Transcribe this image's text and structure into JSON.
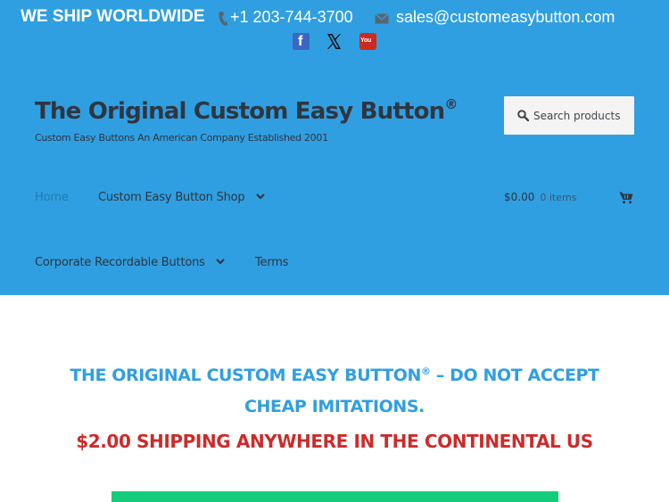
{
  "topbar": {
    "ship_text": "WE SHIP WORLDWIDE",
    "phone": "+1 203-744-3700",
    "email": "sales@customeasybutton.com",
    "icons": [
      "phone-icon",
      "mail-icon"
    ]
  },
  "social": {
    "facebook_glyph": "f",
    "youtube_glyph": "You",
    "icons": [
      "facebook-icon",
      "x-icon",
      "youtube-icon"
    ]
  },
  "site": {
    "title": "The Original Custom Easy Button",
    "title_mark": "®",
    "tagline": "Custom Easy Buttons An American Company Established 2001"
  },
  "search": {
    "placeholder": "Search products"
  },
  "nav": {
    "home": "Home",
    "shop": "Custom Easy Button Shop",
    "corporate": "Corporate Recordable Buttons",
    "terms": "Terms"
  },
  "cart": {
    "amount": "$0.00",
    "items": "0 items"
  },
  "main": {
    "heading_part1": "THE ORIGINAL CUSTOM EASY BUTTON",
    "heading_mark": "®",
    "heading_part2": " – DO NOT ACCEPT CHEAP IMITATIONS.",
    "shipping": "$2.00 SHIPPING ANYWHERE IN THE CONTINENTAL US"
  },
  "colors": {
    "header_bg": "#2f9fe1",
    "text_dark": "#2f3640",
    "heading_blue": "#2f9fe1",
    "shipping_red": "#cd2b2b",
    "bar_green": "#15cc7c"
  }
}
